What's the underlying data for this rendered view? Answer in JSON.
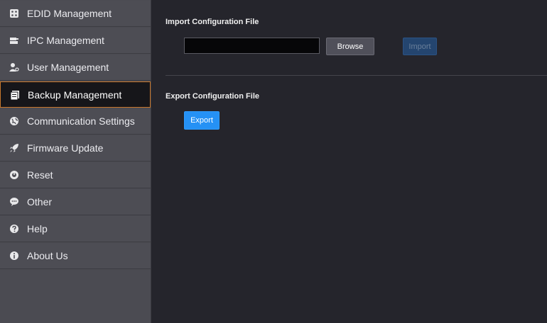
{
  "sidebar": {
    "items": [
      {
        "label": "EDID Management",
        "icon": "edid-icon"
      },
      {
        "label": "IPC Management",
        "icon": "ipc-icon"
      },
      {
        "label": "User Management",
        "icon": "user-icon"
      },
      {
        "label": "Backup Management",
        "icon": "backup-icon"
      },
      {
        "label": "Communication Settings",
        "icon": "globe-icon"
      },
      {
        "label": "Firmware Update",
        "icon": "rocket-icon"
      },
      {
        "label": "Reset",
        "icon": "reset-icon"
      },
      {
        "label": "Other",
        "icon": "chat-icon"
      },
      {
        "label": "Help",
        "icon": "question-icon"
      },
      {
        "label": "About Us",
        "icon": "info-icon"
      }
    ],
    "active_index": 3
  },
  "import": {
    "title": "Import Configuration File",
    "file_value": "",
    "browse_label": "Browse",
    "import_label": "Import"
  },
  "export": {
    "title": "Export Configuration File",
    "export_label": "Export"
  },
  "colors": {
    "active_border": "#c8782c",
    "primary_button": "#2591f5",
    "disabled_button": "#24456f"
  }
}
